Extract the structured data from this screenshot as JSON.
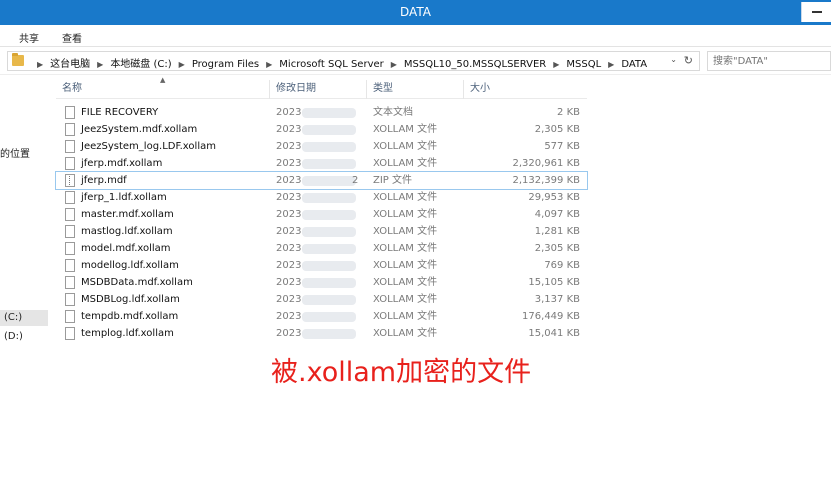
{
  "window": {
    "title": "DATA"
  },
  "ribbon": {
    "tabs": [
      "共享",
      "查看"
    ]
  },
  "address": {
    "crumbs": [
      "这台电脑",
      "本地磁盘 (C:)",
      "Program Files",
      "Microsoft SQL Server",
      "MSSQL10_50.MSSQLSERVER",
      "MSSQL",
      "DATA"
    ]
  },
  "search": {
    "placeholder": "搜索\"DATA\""
  },
  "navpane": {
    "items": [
      "的位置",
      "(C:)",
      "(D:)"
    ]
  },
  "columns": {
    "name": "名称",
    "modified": "修改日期",
    "type": "类型",
    "size": "大小"
  },
  "files": [
    {
      "name": "FILE RECOVERY",
      "date": "2023-",
      "type": "文本文档",
      "size": "2 KB"
    },
    {
      "name": "JeezSystem.mdf.xollam",
      "date": "2023-",
      "type": "XOLLAM 文件",
      "size": "2,305 KB"
    },
    {
      "name": "JeezSystem_log.LDF.xollam",
      "date": "2023-",
      "type": "XOLLAM 文件",
      "size": "577 KB"
    },
    {
      "name": "jferp.mdf.xollam",
      "date": "2023-",
      "type": "XOLLAM 文件",
      "size": "2,320,961 KB"
    },
    {
      "name": "jferp.mdf",
      "date": "2023-",
      "date_tail": "2",
      "type": "ZIP 文件",
      "size": "2,132,399 KB"
    },
    {
      "name": "jferp_1.ldf.xollam",
      "date": "2023-",
      "type": "XOLLAM 文件",
      "size": "29,953 KB"
    },
    {
      "name": "master.mdf.xollam",
      "date": "2023-",
      "type": "XOLLAM 文件",
      "size": "4,097 KB"
    },
    {
      "name": "mastlog.ldf.xollam",
      "date": "2023-",
      "type": "XOLLAM 文件",
      "size": "1,281 KB"
    },
    {
      "name": "model.mdf.xollam",
      "date": "2023-",
      "type": "XOLLAM 文件",
      "size": "2,305 KB"
    },
    {
      "name": "modellog.ldf.xollam",
      "date": "2023-",
      "type": "XOLLAM 文件",
      "size": "769 KB"
    },
    {
      "name": "MSDBData.mdf.xollam",
      "date": "2023-",
      "type": "XOLLAM 文件",
      "size": "15,105 KB"
    },
    {
      "name": "MSDBLog.ldf.xollam",
      "date": "2023-",
      "type": "XOLLAM 文件",
      "size": "3,137 KB"
    },
    {
      "name": "tempdb.mdf.xollam",
      "date": "2023-",
      "type": "XOLLAM 文件",
      "size": "176,449 KB"
    },
    {
      "name": "templog.ldf.xollam",
      "date": "2023-",
      "type": "XOLLAM 文件",
      "size": "15,041 KB"
    }
  ],
  "caption": "被.xollam加密的文件",
  "colors": {
    "titlebar": "#1979ca",
    "caption": "#e8211c",
    "selection_border": "#99c8ee"
  }
}
